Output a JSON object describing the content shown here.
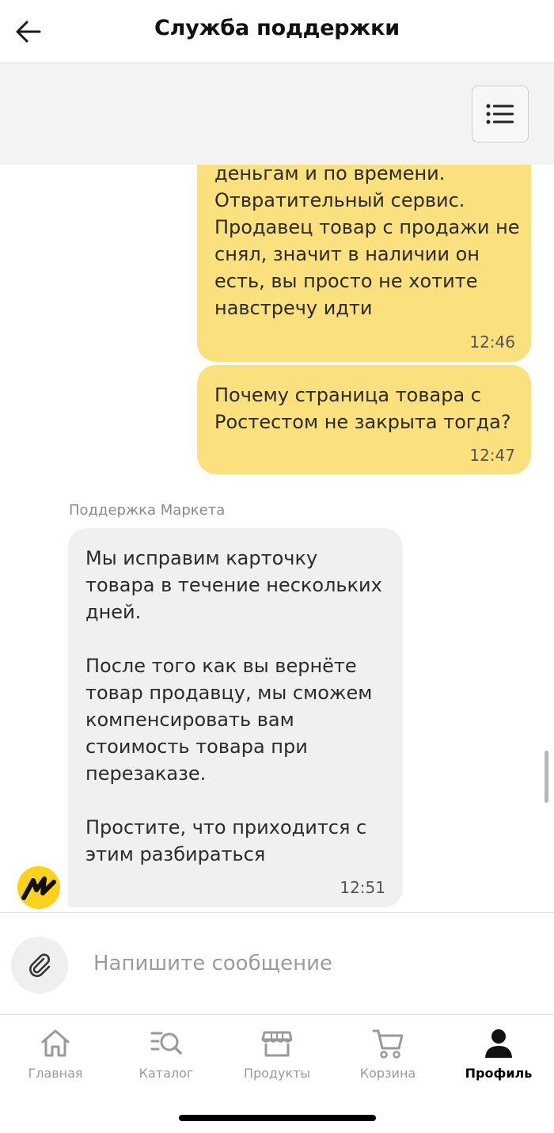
{
  "header": {
    "title": "Служба поддержки"
  },
  "messages": [
    {
      "direction": "out",
      "text": "деньгам и по времени.\nОтвратительный сервис.\nПродавец товар с продажи не\nснял, значит в наличии он\nесть, вы просто не хотите\nнавстречу идти",
      "time": "12:46"
    },
    {
      "direction": "out",
      "text": "Почему страница товара с\nРостестом не закрыта тогда?",
      "time": "12:47"
    },
    {
      "direction": "in",
      "sender": "Поддержка Маркета",
      "text": "Мы исправим карточку\nтовара в течение нескольких\nдней.\n\nПосле того как вы вернёте\nтовар продавцу, мы сможем\nкомпенсировать вам\nстоимость товара при\nперезаказе.\n\nПростите, что приходится с\nэтим разбираться",
      "time": "12:51"
    }
  ],
  "composer": {
    "placeholder": "Напишите сообщение"
  },
  "tabs": [
    {
      "label": "Главная",
      "icon": "home-icon",
      "active": false
    },
    {
      "label": "Каталог",
      "icon": "catalog-search-icon",
      "active": false
    },
    {
      "label": "Продукты",
      "icon": "store-icon",
      "active": false
    },
    {
      "label": "Корзина",
      "icon": "cart-icon",
      "active": false
    },
    {
      "label": "Профиль",
      "icon": "profile-icon",
      "active": true
    }
  ],
  "colors": {
    "outgoing_bubble": "#fae17d",
    "incoming_bubble": "#f0f0f0",
    "brand_yellow": "#fcd21c"
  }
}
